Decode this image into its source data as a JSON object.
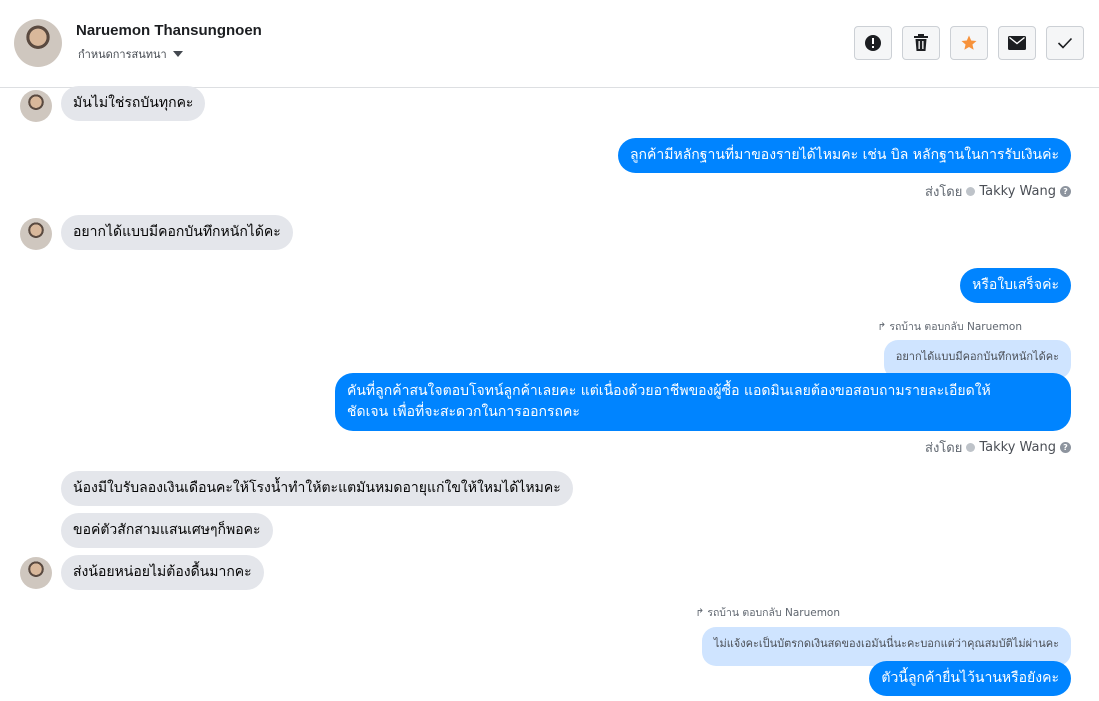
{
  "header": {
    "contact_name": "Naruemon Thansungnoen",
    "contact_sub": "กำหนดการสนทนา"
  },
  "toolbar": {
    "icons": [
      "alert-icon",
      "trash-icon",
      "star-icon",
      "envelope-icon",
      "check-icon"
    ],
    "star_color": "#f7923b"
  },
  "messages": {
    "m1": "มันไม่ใช่รถบันทุกคะ",
    "m2": "ลูกค้ามีหลักฐานที่มาของรายได้ไหมคะ เช่น บิล หลักฐานในการรับเงินค่ะ",
    "m3": "อยากได้แบบมีคอกบันทึกหนักได้คะ",
    "m4": "หรือใบเสร็จค่ะ",
    "m5_line1": "คันที่ลูกค้าสนใจตอบโจทน์ลูกค้าเลยคะ แต่เนื่องด้วยอาชีพของผู้ซื้อ แอดมินเลยต้องขอสอบถามรายละเอียดให้",
    "m5_line2": "ชัดเจน เพื่อที่จะสะดวกในการออกรถคะ",
    "m6": "น้องมีใบรับลองเงินเดือนคะให้โรงน้ำทำให้ตะแตมันหมดอายุแก่ใขให้ใหมได้ไหมคะ",
    "m7": "ขอค่ตัวสักสามแสนเศษๆก็พอคะ",
    "m8": "ส่งน้อยหน่อยไม่ต้องดื้นมากคะ",
    "m9": "ตัวนี้ลูกค้ายื่นไว้นานหรือยังคะ"
  },
  "replies": {
    "r1_note": "รถบ้าน ตอบกลับ Naruemon",
    "r1_quote": "อยากได้แบบมีคอกบันทึกหนักได้คะ",
    "r2_note": "รถบ้าน ตอบกลับ Naruemon",
    "r2_quote": "ไม่แจ้งคะเป็นบัตรกดเงินสดของเอมันนี่นะคะบอกแต่ว่าคุณสมบัติไม่ผ่านคะ"
  },
  "sent_by": {
    "label": "ส่งโดย",
    "agent": "Takky Wang"
  },
  "colors": {
    "outgoing": "#0084ff",
    "incoming": "#e4e6eb",
    "quoted": "#cfe4ff"
  }
}
